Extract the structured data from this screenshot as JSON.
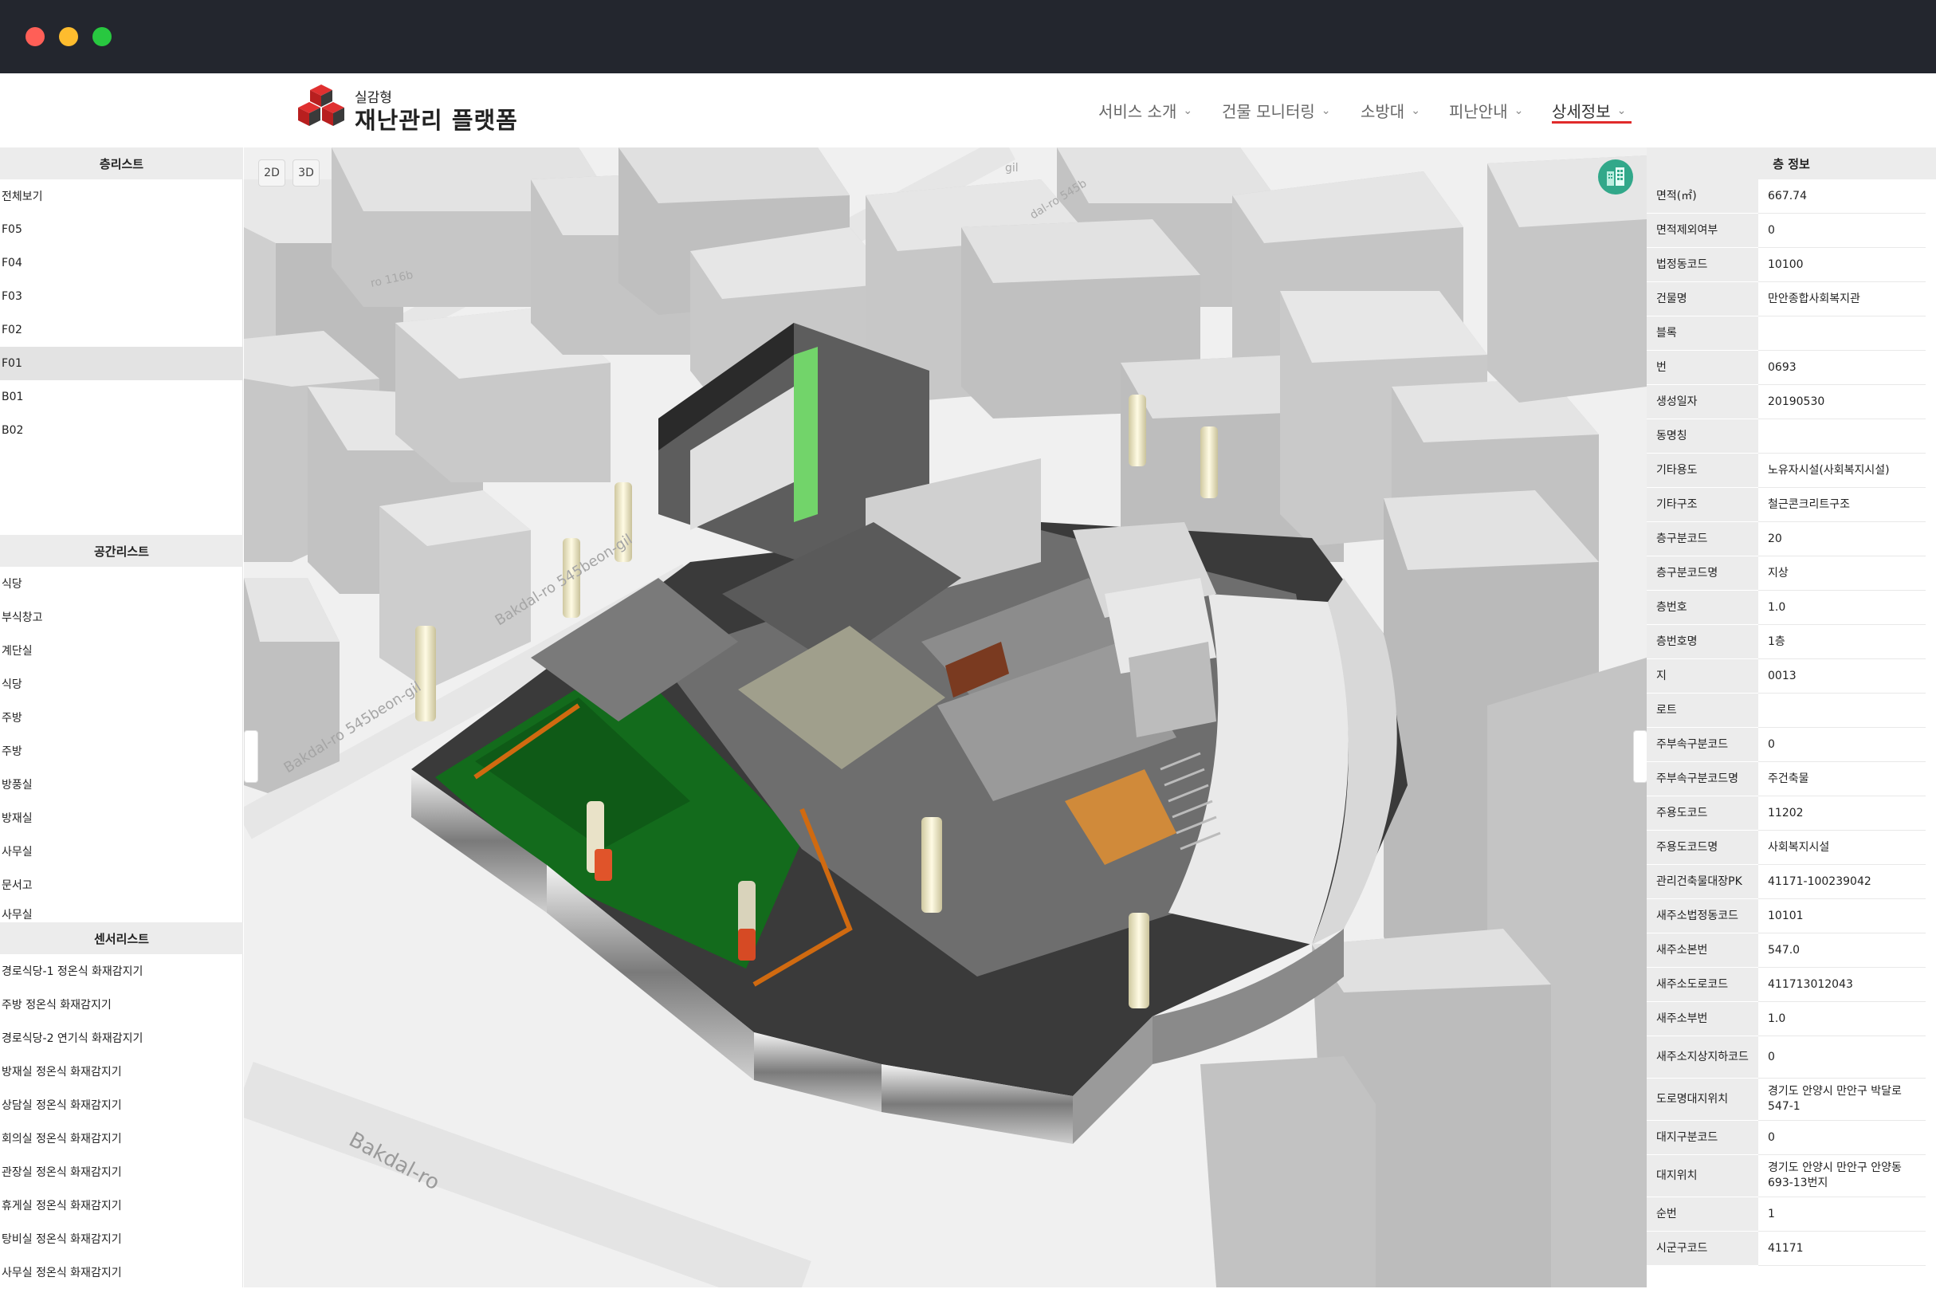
{
  "brand": {
    "sub": "실감형",
    "main": "재난관리 플랫폼"
  },
  "nav": [
    {
      "label": "서비스 소개",
      "active": false
    },
    {
      "label": "건물 모니터링",
      "active": false
    },
    {
      "label": "소방대",
      "active": false
    },
    {
      "label": "피난안내",
      "active": false
    },
    {
      "label": "상세정보",
      "active": true
    }
  ],
  "floor_list": {
    "title": "층리스트",
    "items": [
      "전체보기",
      "F05",
      "F04",
      "F03",
      "F02",
      "F01",
      "B01",
      "B02"
    ],
    "selected": "F01"
  },
  "space_list": {
    "title": "공간리스트",
    "items": [
      "식당",
      "부식창고",
      "계단실",
      "식당",
      "주방",
      "주방",
      "방풍실",
      "방재실",
      "사무실",
      "문서고",
      "사무실"
    ]
  },
  "sensor_list": {
    "title": "센서리스트",
    "items": [
      "경로식당-1 정온식 화재감지기",
      "주방 정온식 화재감지기",
      "경로식당-2 연기식 화재감지기",
      "방재실 정온식 화재감지기",
      "상담실 정온식 화재감지기",
      "회의실 정온식 화재감지기",
      "관장실 정온식 화재감지기",
      "휴게실 정온식 화재감지기",
      "탕비실 정온식 화재감지기",
      "사무실 정온식 화재감지기"
    ]
  },
  "map": {
    "view_2d": "2D",
    "view_3d": "3D",
    "streets": [
      "Bakdal-ro",
      "Bakdal-ro 545beon-gil",
      "Bakdal-ro 545beon-gil",
      "ro 116b",
      "dal-ro 545b",
      "gil"
    ]
  },
  "floor_info": {
    "title": "층 정보",
    "rows": [
      {
        "k": "면적(㎡)",
        "v": "667.74"
      },
      {
        "k": "면적제외여부",
        "v": "0"
      },
      {
        "k": "법정동코드",
        "v": "10100"
      },
      {
        "k": "건물명",
        "v": "만안종합사회복지관"
      },
      {
        "k": "블록",
        "v": ""
      },
      {
        "k": "번",
        "v": "0693"
      },
      {
        "k": "생성일자",
        "v": "20190530"
      },
      {
        "k": "동명칭",
        "v": ""
      },
      {
        "k": "기타용도",
        "v": "노유자시설(사회복지시설)"
      },
      {
        "k": "기타구조",
        "v": "철근콘크리트구조"
      },
      {
        "k": "층구분코드",
        "v": "20"
      },
      {
        "k": "층구분코드명",
        "v": "지상"
      },
      {
        "k": "층번호",
        "v": "1.0"
      },
      {
        "k": "층번호명",
        "v": "1층"
      },
      {
        "k": "지",
        "v": "0013"
      },
      {
        "k": "로트",
        "v": ""
      },
      {
        "k": "주부속구분코드",
        "v": "0"
      },
      {
        "k": "주부속구분코드명",
        "v": "주건축물"
      },
      {
        "k": "주용도코드",
        "v": "11202"
      },
      {
        "k": "주용도코드명",
        "v": "사회복지시설"
      },
      {
        "k": "관리건축물대장PK",
        "v": "41171-100239042"
      },
      {
        "k": "새주소법정동코드",
        "v": "10101"
      },
      {
        "k": "새주소본번",
        "v": "547.0"
      },
      {
        "k": "새주소도로코드",
        "v": "411713012043"
      },
      {
        "k": "새주소부번",
        "v": "1.0"
      },
      {
        "k": "새주소지상지하코드",
        "v": "0"
      },
      {
        "k": "도로명대지위치",
        "v": "경기도 안양시 만안구 박달로 547-1"
      },
      {
        "k": "대지구분코드",
        "v": "0"
      },
      {
        "k": "대지위치",
        "v": "경기도 안양시 만안구 안양동 693-13번지"
      },
      {
        "k": "순번",
        "v": "1"
      },
      {
        "k": "시군구코드",
        "v": "41171"
      }
    ]
  }
}
